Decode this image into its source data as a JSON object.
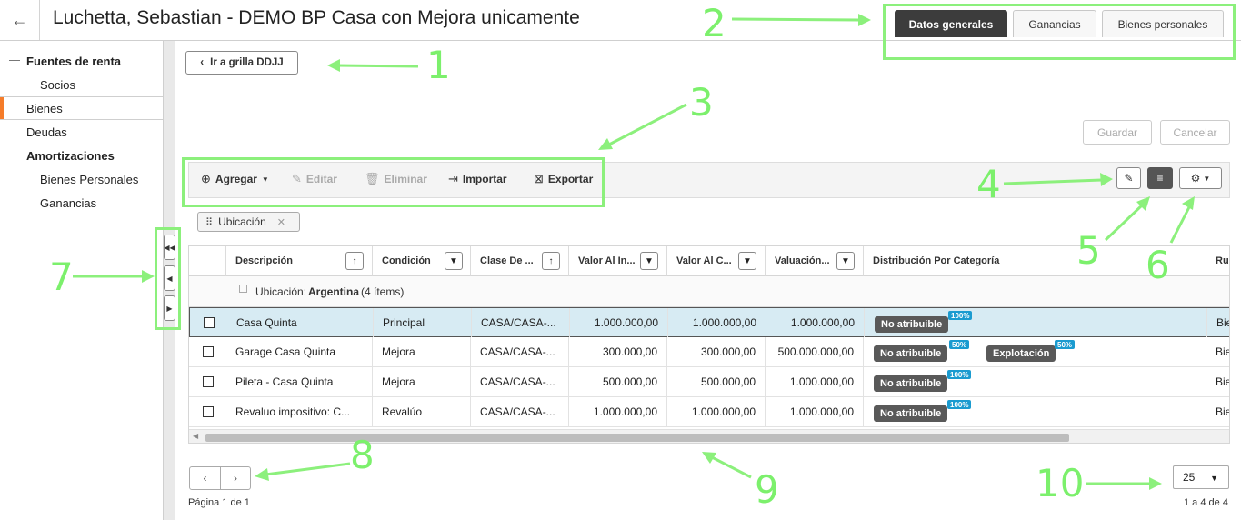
{
  "header": {
    "back_label": "←",
    "title": "Luchetta, Sebastian - DEMO BP Casa con Mejora unicamente",
    "tabs": [
      {
        "label": "Datos generales",
        "active": true
      },
      {
        "label": "Ganancias",
        "active": false
      },
      {
        "label": "Bienes personales",
        "active": false
      }
    ]
  },
  "sidebar": {
    "items": [
      {
        "label": "Fuentes de renta"
      },
      {
        "label": "Socios"
      },
      {
        "label": "Bienes"
      },
      {
        "label": "Deudas"
      },
      {
        "label": "Amortizaciones"
      },
      {
        "label": "Bienes Personales"
      },
      {
        "label": "Ganancias"
      }
    ]
  },
  "splitter": {
    "buttons": [
      "◀◀",
      "◀",
      "▶"
    ]
  },
  "main": {
    "goto_label": "Ir a grilla DDJJ",
    "save_label": "Guardar",
    "cancel_label": "Cancelar",
    "toolbar": {
      "add": "Agregar",
      "edit": "Editar",
      "delete": "Eliminar",
      "import": "Importar",
      "export": "Exportar"
    },
    "group_chip": "Ubicación"
  },
  "grid": {
    "columns": [
      "Descripción",
      "Condición",
      "Clase De ...",
      "Valor Al In...",
      "Valor Al C...",
      "Valuación...",
      "Distribución Por Categoría",
      "Ru"
    ],
    "group": {
      "label": "Ubicación:",
      "value": "Argentina",
      "count": "(4 ítems)"
    },
    "rows": [
      {
        "descripcion": "Casa Quinta",
        "condicion": "Principal",
        "clase": "CASA/CASA-...",
        "valor_inicio": "1.000.000,00",
        "valor_cierre": "1.000.000,00",
        "valuacion": "1.000.000,00",
        "tags": [
          {
            "label": "No atribuible",
            "pct": "100%"
          }
        ],
        "ru": "Bie"
      },
      {
        "descripcion": "Garage Casa Quinta",
        "condicion": "Mejora",
        "clase": "CASA/CASA-...",
        "valor_inicio": "300.000,00",
        "valor_cierre": "300.000,00",
        "valuacion": "500.000.000,00",
        "tags": [
          {
            "label": "No atribuible",
            "pct": "50%"
          },
          {
            "label": "Explotación",
            "pct": "50%"
          }
        ],
        "ru": "Bie"
      },
      {
        "descripcion": "Pileta - Casa Quinta",
        "condicion": "Mejora",
        "clase": "CASA/CASA-...",
        "valor_inicio": "500.000,00",
        "valor_cierre": "500.000,00",
        "valuacion": "1.000.000,00",
        "tags": [
          {
            "label": "No atribuible",
            "pct": "100%"
          }
        ],
        "ru": "Bie"
      },
      {
        "descripcion": "Revaluo impositivo: C...",
        "condicion": "Revalúo",
        "clase": "CASA/CASA-...",
        "valor_inicio": "1.000.000,00",
        "valor_cierre": "1.000.000,00",
        "valuacion": "1.000.000,00",
        "tags": [
          {
            "label": "No atribuible",
            "pct": "100%"
          }
        ],
        "ru": "Bie"
      }
    ]
  },
  "pager": {
    "page_info": "Página 1 de 1",
    "page_size": "25",
    "range": "1 a 4 de 4"
  },
  "annotations": [
    "1",
    "2",
    "3",
    "4",
    "5",
    "6",
    "7",
    "8",
    "9",
    "10"
  ],
  "colors": {
    "annotation": "#7cf06c",
    "accent": "#f57c2a",
    "tag": "#595959",
    "pct": "#1a9bd0",
    "selected_row": "#d7ebf3"
  }
}
